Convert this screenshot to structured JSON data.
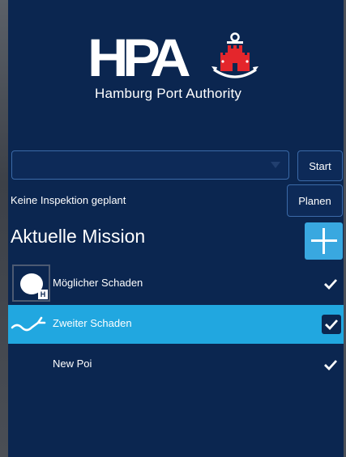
{
  "logo": {
    "text": "HPA",
    "subtitle": "Hamburg Port Authority"
  },
  "controls": {
    "mission_select_value": "",
    "start_label": "Start",
    "plan_label": "Planen",
    "status_text": "Keine Inspektion geplant"
  },
  "mission": {
    "title": "Aktuelle Mission",
    "add_icon": "plus-icon",
    "items": [
      {
        "label": "Möglicher Schaden",
        "icon": "point-marker-icon",
        "checked": true,
        "selected": false
      },
      {
        "label": "Zweiter Schaden",
        "icon": "crack-line-icon",
        "checked": true,
        "selected": true
      },
      {
        "label": "New Poi",
        "icon": "",
        "checked": true,
        "selected": false
      }
    ]
  },
  "colors": {
    "background": "#0b2650",
    "accent": "#21a7e0",
    "brand_red": "#e4262c",
    "border": "#3b6aa8"
  }
}
